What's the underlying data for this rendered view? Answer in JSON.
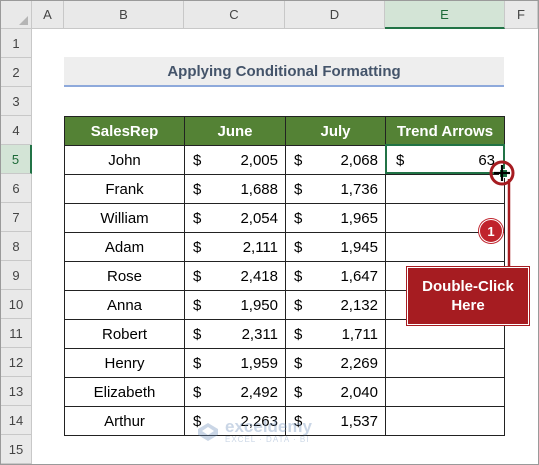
{
  "columns": [
    "A",
    "B",
    "C",
    "D",
    "E",
    "F"
  ],
  "rows": [
    "1",
    "2",
    "3",
    "4",
    "5",
    "6",
    "7",
    "8",
    "9",
    "10",
    "11",
    "12",
    "13",
    "14",
    "15"
  ],
  "title": "Applying Conditional Formatting",
  "headers": {
    "salesrep": "SalesRep",
    "june": "June",
    "july": "July",
    "trend": "Trend Arrows"
  },
  "currency_symbol": "$",
  "records": [
    {
      "name": "John",
      "june": "2,005",
      "july": "2,068"
    },
    {
      "name": "Frank",
      "june": "1,688",
      "july": "1,736"
    },
    {
      "name": "William",
      "june": "2,054",
      "july": "1,965"
    },
    {
      "name": "Adam",
      "june": "2,111",
      "july": "1,945"
    },
    {
      "name": "Rose",
      "june": "2,418",
      "july": "1,647"
    },
    {
      "name": "Anna",
      "june": "1,950",
      "july": "2,132"
    },
    {
      "name": "Robert",
      "june": "2,311",
      "july": "1,711"
    },
    {
      "name": "Henry",
      "june": "1,959",
      "july": "2,269"
    },
    {
      "name": "Elizabeth",
      "june": "2,492",
      "july": "2,040"
    },
    {
      "name": "Arthur",
      "june": "2,263",
      "july": "1,537"
    }
  ],
  "trend_first": {
    "symbol": "$",
    "value": "63"
  },
  "annotation": {
    "step": "1",
    "callout": "Double-Click Here"
  },
  "watermark": {
    "name": "exceldemy",
    "tagline": "EXCEL · DATA · BI"
  },
  "colors": {
    "header_fill": "#548235",
    "accent": "#217346",
    "callout": "#a61c21"
  }
}
